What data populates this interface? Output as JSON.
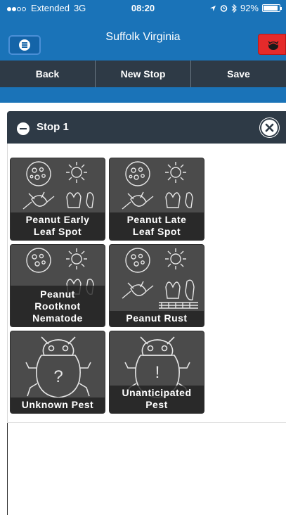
{
  "status_bar": {
    "carrier": "Extended",
    "network": "3G",
    "time": "08:20",
    "battery_percent": "92%",
    "battery_level": 0.92
  },
  "header": {
    "title": "Suffolk Virginia",
    "menu_icon": "list-icon",
    "alert_icon": "pest-alert-icon",
    "accent_color": "#1a73b8"
  },
  "toolbar": {
    "back_label": "Back",
    "new_stop_label": "New Stop",
    "save_label": "Save"
  },
  "stop": {
    "label": "Stop 1",
    "collapse_icon": "minus-circle-icon",
    "close_icon": "close-circle-icon"
  },
  "pests": [
    {
      "line1": "Peanut Early",
      "line2": "Leaf Spot",
      "icon": "disease-illustration-icon"
    },
    {
      "line1": "Peanut Late",
      "line2": "Leaf Spot",
      "icon": "disease-illustration-icon"
    },
    {
      "line1": "Peanut",
      "line2": "Rootknot",
      "line3": "Nematode",
      "icon": "disease-illustration-icon"
    },
    {
      "line1": "Peanut Rust",
      "icon": "disease-illustration-icon"
    },
    {
      "line1": "Unknown Pest",
      "symbol": "?",
      "icon": "bug-question-icon"
    },
    {
      "line1": "Unanticipated",
      "line2": "Pest",
      "symbol": "!",
      "icon": "bug-exclamation-icon"
    }
  ]
}
